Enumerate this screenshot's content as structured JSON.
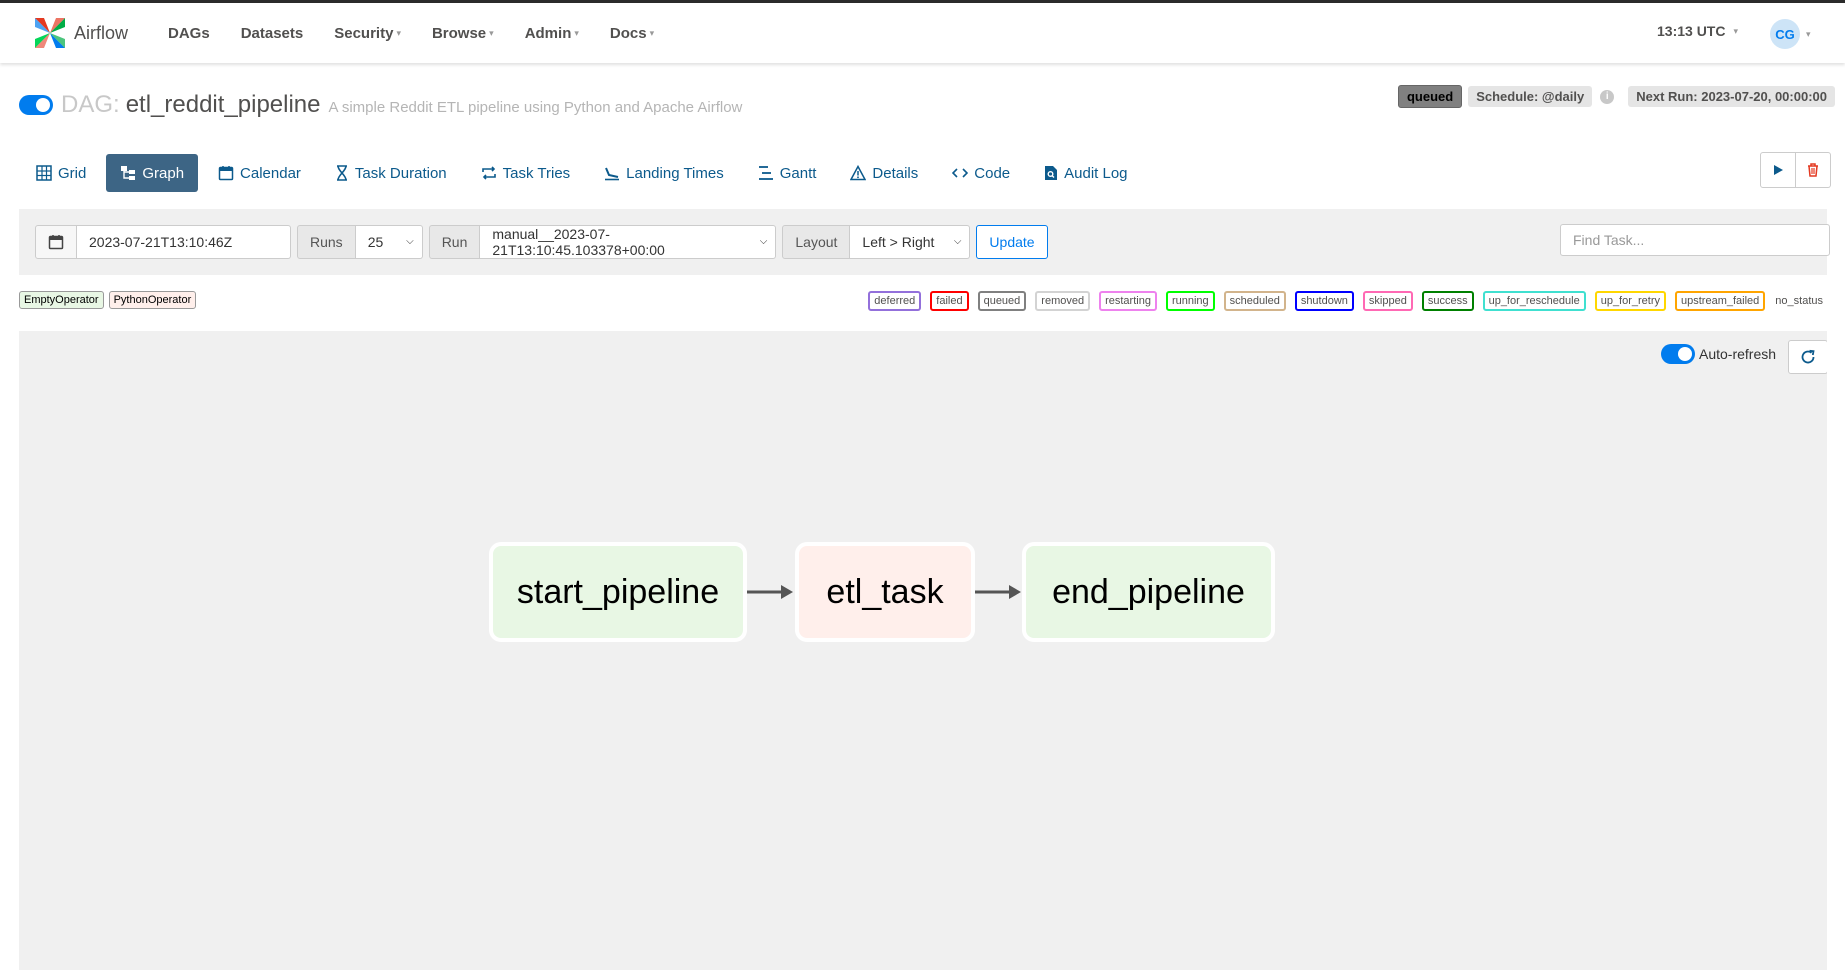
{
  "app": {
    "brand": "Airflow",
    "nav": [
      {
        "label": "DAGs",
        "dropdown": false
      },
      {
        "label": "Datasets",
        "dropdown": false
      },
      {
        "label": "Security",
        "dropdown": true
      },
      {
        "label": "Browse",
        "dropdown": true
      },
      {
        "label": "Admin",
        "dropdown": true
      },
      {
        "label": "Docs",
        "dropdown": true
      }
    ],
    "time": "13:13 UTC",
    "user_initials": "CG"
  },
  "dag": {
    "prefix": "DAG:",
    "id": "etl_reddit_pipeline",
    "description": "A simple Reddit ETL pipeline using Python and Apache Airflow",
    "paused": false,
    "state_badge": "queued",
    "schedule": "Schedule: @daily",
    "next_run": "Next Run: 2023-07-20, 00:00:00"
  },
  "tabs": [
    {
      "label": "Grid",
      "icon": "grid-icon"
    },
    {
      "label": "Graph",
      "icon": "graph-icon",
      "active": true
    },
    {
      "label": "Calendar",
      "icon": "calendar-icon"
    },
    {
      "label": "Task Duration",
      "icon": "hourglass-icon"
    },
    {
      "label": "Task Tries",
      "icon": "repeat-icon"
    },
    {
      "label": "Landing Times",
      "icon": "landing-icon"
    },
    {
      "label": "Gantt",
      "icon": "gantt-icon"
    },
    {
      "label": "Details",
      "icon": "warning-icon"
    },
    {
      "label": "Code",
      "icon": "code-icon"
    },
    {
      "label": "Audit Log",
      "icon": "file-search-icon"
    }
  ],
  "filters": {
    "base_date": "2023-07-21T13:10:46Z",
    "runs_label": "Runs",
    "runs_value": "25",
    "run_label": "Run",
    "run_value": "manual__2023-07-21T13:10:45.103378+00:00",
    "layout_label": "Layout",
    "layout_value": "Left > Right",
    "update_label": "Update",
    "find_task_placeholder": "Find Task..."
  },
  "operators": [
    {
      "label": "EmptyOperator",
      "color": "#e8f7e4"
    },
    {
      "label": "PythonOperator",
      "color": "#ffefeb"
    }
  ],
  "states": [
    {
      "label": "deferred",
      "color": "#9370db"
    },
    {
      "label": "failed",
      "color": "#ff0000"
    },
    {
      "label": "queued",
      "color": "#808080"
    },
    {
      "label": "removed",
      "color": "#d3d3d3"
    },
    {
      "label": "restarting",
      "color": "#ee82ee"
    },
    {
      "label": "running",
      "color": "#00ff00"
    },
    {
      "label": "scheduled",
      "color": "#d2b48c"
    },
    {
      "label": "shutdown",
      "color": "#0000ff"
    },
    {
      "label": "skipped",
      "color": "#ff69b4"
    },
    {
      "label": "success",
      "color": "#008000"
    },
    {
      "label": "up_for_reschedule",
      "color": "#40e0d0"
    },
    {
      "label": "up_for_retry",
      "color": "#ffd700"
    },
    {
      "label": "upstream_failed",
      "color": "#ffa500"
    },
    {
      "label": "no_status",
      "color": null
    }
  ],
  "graph": {
    "autorefresh_label": "Auto-refresh",
    "tasks": [
      {
        "id": "start_pipeline",
        "operator": "EmptyOperator"
      },
      {
        "id": "etl_task",
        "operator": "PythonOperator"
      },
      {
        "id": "end_pipeline",
        "operator": "EmptyOperator"
      }
    ],
    "edges": [
      {
        "from": "start_pipeline",
        "to": "etl_task"
      },
      {
        "from": "etl_task",
        "to": "end_pipeline"
      }
    ]
  }
}
